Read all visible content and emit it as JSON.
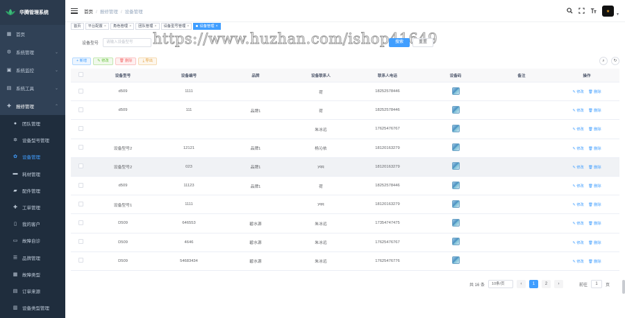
{
  "sidebar": {
    "logo": "华腾管理系统",
    "menu": [
      {
        "label": "首页",
        "icon": "dashboard-icon",
        "glyph": "▦"
      },
      {
        "label": "系统管理",
        "icon": "gear-icon",
        "glyph": "⚙",
        "arrow": "⌄"
      },
      {
        "label": "系统监控",
        "icon": "monitor-icon",
        "glyph": "▣",
        "arrow": "⌄"
      },
      {
        "label": "系统工具",
        "icon": "tool-icon",
        "glyph": "▤",
        "arrow": "⌄"
      },
      {
        "label": "报修管理",
        "icon": "plus-icon",
        "glyph": "✚",
        "arrow": "⌃"
      }
    ],
    "submenu": [
      {
        "label": "团队管理",
        "icon": "user-icon",
        "glyph": "●"
      },
      {
        "label": "设备型号管理",
        "icon": "cog-icon",
        "glyph": "✲"
      },
      {
        "label": "设备管理",
        "icon": "gear-icon",
        "glyph": "✿",
        "active": true
      },
      {
        "label": "耗材管理",
        "icon": "box-icon",
        "glyph": "▬"
      },
      {
        "label": "配件管理",
        "icon": "truck-icon",
        "glyph": "▰"
      },
      {
        "label": "工单管理",
        "icon": "plus-icon",
        "glyph": "✚"
      },
      {
        "label": "我的客户",
        "icon": "document-icon",
        "glyph": "▯"
      },
      {
        "label": "故障自诊",
        "icon": "table-icon",
        "glyph": "▭"
      },
      {
        "label": "品牌管理",
        "icon": "list-icon",
        "glyph": "☰"
      },
      {
        "label": "故障类型",
        "icon": "grid-icon",
        "glyph": "▦"
      },
      {
        "label": "订单来源",
        "icon": "doc-icon",
        "glyph": "▤"
      },
      {
        "label": "设备类型管理",
        "icon": "chart-icon",
        "glyph": "▥"
      },
      {
        "label": "配件分类管理",
        "icon": "folder-icon",
        "glyph": "▨"
      }
    ]
  },
  "header": {
    "crumbs": [
      "首页",
      "报修管理",
      "设备管理"
    ],
    "avatar_text": "★"
  },
  "tags": [
    {
      "label": "首页"
    },
    {
      "label": "平台配置",
      "close": "×"
    },
    {
      "label": "角色管理",
      "close": "×"
    },
    {
      "label": "团队管理",
      "close": "×"
    },
    {
      "label": "设备型号管理",
      "close": "×"
    },
    {
      "label": "设备管理",
      "close": "×",
      "active": true
    }
  ],
  "search": {
    "label_model": "设备型号",
    "placeholder_model": "请输入设备型号",
    "search_label": "搜索",
    "reset_label": "重置"
  },
  "watermark": "https://www.huzhan.com/ishop41649",
  "actions": {
    "add": "+ 新增",
    "edit": "✎ 修改",
    "delete": "🗑 删除",
    "export": "⤓ 导出"
  },
  "table": {
    "headers": [
      "设备型号",
      "设备编号",
      "品牌",
      "设备联系人",
      "联系人电话",
      "设备码",
      "备注",
      "操作"
    ],
    "edit_label": "✎ 修改",
    "delete_label": "🗑 删除",
    "rows": [
      {
        "model": "d509",
        "code": "1111",
        "brand": "",
        "contact": "荷",
        "phone": "18252578446",
        "note": ""
      },
      {
        "model": "d509",
        "code": "111",
        "brand": "品牌1",
        "contact": "荷",
        "phone": "18252578446",
        "note": ""
      },
      {
        "model": "",
        "code": "",
        "brand": "",
        "contact": "朱冰远",
        "phone": "17625476767",
        "note": ""
      },
      {
        "model": "设备型号2",
        "code": "12121",
        "brand": "品牌1",
        "contact": "杨沁依",
        "phone": "18120163279",
        "note": ""
      },
      {
        "model": "设备型号2",
        "code": "023",
        "brand": "品牌1",
        "contact": "yqq",
        "phone": "18120163279",
        "note": "",
        "highlight": true
      },
      {
        "model": "d509",
        "code": "11123",
        "brand": "品牌1",
        "contact": "荷",
        "phone": "18252578446",
        "note": ""
      },
      {
        "model": "设备型号1",
        "code": "1111",
        "brand": "",
        "contact": "yqq",
        "phone": "18120163279",
        "note": ""
      },
      {
        "model": "D509",
        "code": "646553",
        "brand": "碧水源",
        "contact": "朱冰远",
        "phone": "17354747475",
        "note": ""
      },
      {
        "model": "D509",
        "code": "4646",
        "brand": "碧水源",
        "contact": "朱冰远",
        "phone": "17625476767",
        "note": ""
      },
      {
        "model": "D509",
        "code": "54683434",
        "brand": "碧水源",
        "contact": "朱冰远",
        "phone": "17625476776",
        "note": ""
      }
    ]
  },
  "pagination": {
    "total": "共 16 条",
    "page_size": "10条/页",
    "prev": "‹",
    "pages": [
      "1",
      "2"
    ],
    "next": "›",
    "goto_label": "前往",
    "goto_value": "1",
    "page_unit": "页"
  }
}
